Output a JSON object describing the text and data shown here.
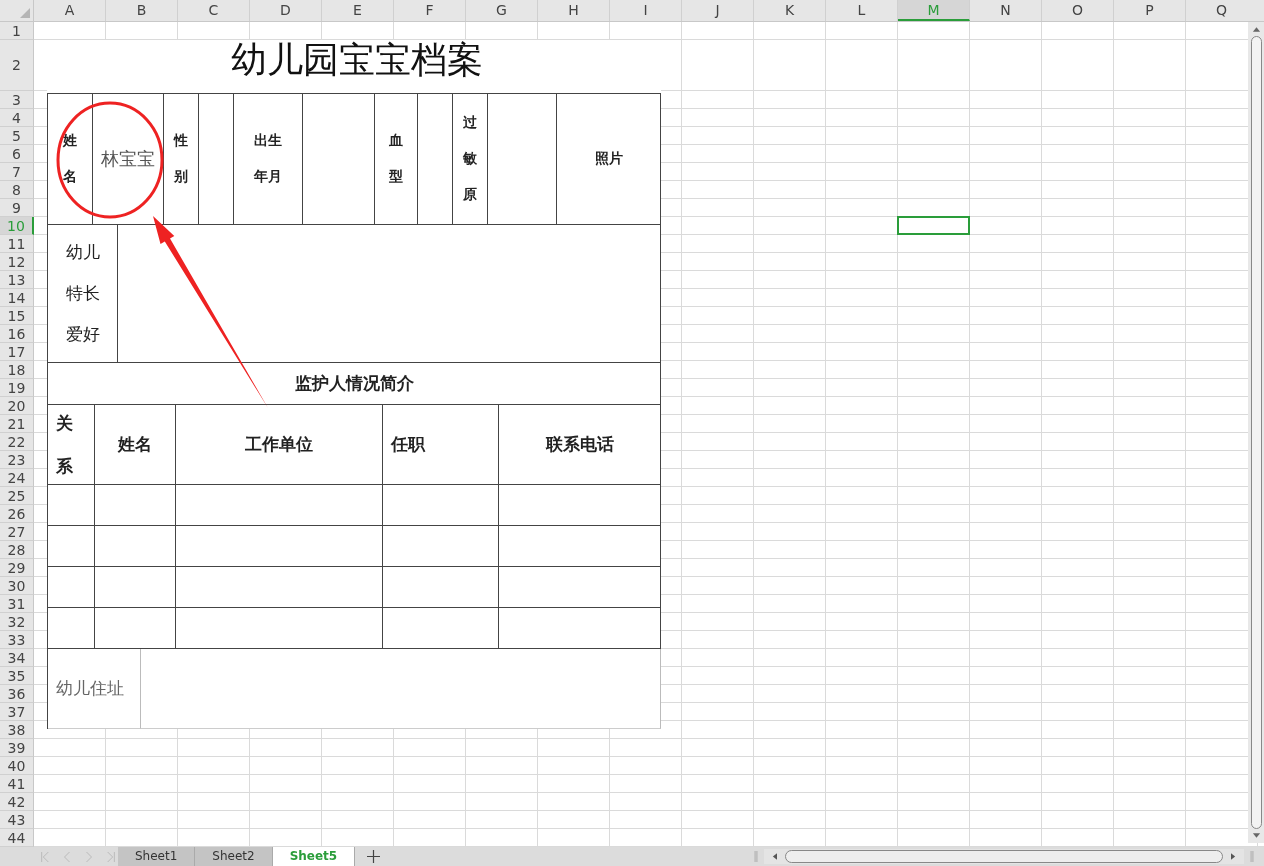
{
  "sheet": {
    "columns": [
      {
        "label": "A",
        "selected": false
      },
      {
        "label": "B",
        "selected": false
      },
      {
        "label": "C",
        "selected": false
      },
      {
        "label": "D",
        "selected": false
      },
      {
        "label": "E",
        "selected": false
      },
      {
        "label": "F",
        "selected": false
      },
      {
        "label": "G",
        "selected": false
      },
      {
        "label": "H",
        "selected": false
      },
      {
        "label": "I",
        "selected": false
      },
      {
        "label": "J",
        "selected": false
      },
      {
        "label": "K",
        "selected": false
      },
      {
        "label": "L",
        "selected": false
      },
      {
        "label": "M",
        "selected": true
      },
      {
        "label": "N",
        "selected": false
      },
      {
        "label": "O",
        "selected": false
      },
      {
        "label": "P",
        "selected": false
      },
      {
        "label": "Q",
        "selected": false
      }
    ],
    "rows": [
      {
        "label": "1",
        "selected": false
      },
      {
        "label": "2",
        "selected": false
      },
      {
        "label": "3",
        "selected": false
      },
      {
        "label": "4",
        "selected": false
      },
      {
        "label": "5",
        "selected": false
      },
      {
        "label": "6",
        "selected": false
      },
      {
        "label": "7",
        "selected": false
      },
      {
        "label": "8",
        "selected": false
      },
      {
        "label": "9",
        "selected": false
      },
      {
        "label": "10",
        "selected": true
      },
      {
        "label": "11",
        "selected": false
      },
      {
        "label": "12",
        "selected": false
      },
      {
        "label": "13",
        "selected": false
      },
      {
        "label": "14",
        "selected": false
      },
      {
        "label": "15",
        "selected": false
      },
      {
        "label": "16",
        "selected": false
      },
      {
        "label": "17",
        "selected": false
      },
      {
        "label": "18",
        "selected": false
      },
      {
        "label": "19",
        "selected": false
      },
      {
        "label": "20",
        "selected": false
      },
      {
        "label": "21",
        "selected": false
      },
      {
        "label": "22",
        "selected": false
      },
      {
        "label": "23",
        "selected": false
      },
      {
        "label": "24",
        "selected": false
      },
      {
        "label": "25",
        "selected": false
      },
      {
        "label": "26",
        "selected": false
      },
      {
        "label": "27",
        "selected": false
      },
      {
        "label": "28",
        "selected": false
      },
      {
        "label": "29",
        "selected": false
      },
      {
        "label": "30",
        "selected": false
      },
      {
        "label": "31",
        "selected": false
      },
      {
        "label": "32",
        "selected": false
      },
      {
        "label": "33",
        "selected": false
      },
      {
        "label": "34",
        "selected": false
      },
      {
        "label": "35",
        "selected": false
      },
      {
        "label": "36",
        "selected": false
      },
      {
        "label": "37",
        "selected": false
      },
      {
        "label": "38",
        "selected": false
      },
      {
        "label": "39",
        "selected": false
      },
      {
        "label": "40",
        "selected": false
      },
      {
        "label": "41",
        "selected": false
      },
      {
        "label": "42",
        "selected": false
      },
      {
        "label": "43",
        "selected": false
      },
      {
        "label": "44",
        "selected": false
      }
    ]
  },
  "form": {
    "title": "幼儿园宝宝档案",
    "info_row": [
      {
        "kind": "label",
        "lines": [
          "姓",
          "名"
        ]
      },
      {
        "kind": "value",
        "text": "林宝宝"
      },
      {
        "kind": "label",
        "lines": [
          "性",
          "别"
        ]
      },
      {
        "kind": "blank"
      },
      {
        "kind": "label",
        "lines": [
          "出生",
          "年月"
        ]
      },
      {
        "kind": "blank"
      },
      {
        "kind": "label",
        "lines": [
          "血",
          "型"
        ]
      },
      {
        "kind": "blank"
      },
      {
        "kind": "label",
        "lines": [
          "过",
          "敏",
          "原"
        ]
      },
      {
        "kind": "blank"
      },
      {
        "kind": "label",
        "lines": [
          "照片"
        ]
      }
    ],
    "hobbies_label": [
      "幼儿",
      "特长",
      "爱好"
    ],
    "guardian_title": "监护人情况简介",
    "guardian_columns": [
      {
        "lines": [
          "关",
          "系"
        ]
      },
      {
        "lines": [
          "姓名"
        ]
      },
      {
        "lines": [
          "工作单位"
        ]
      },
      {
        "lines": [
          "任职"
        ]
      },
      {
        "lines": [
          "联系电话"
        ]
      }
    ],
    "address_label": "幼儿住址"
  },
  "sheet_tabs": [
    {
      "label": "Sheet1",
      "selected": false
    },
    {
      "label": "Sheet2",
      "selected": false
    },
    {
      "label": "Sheet5",
      "selected": true
    }
  ]
}
